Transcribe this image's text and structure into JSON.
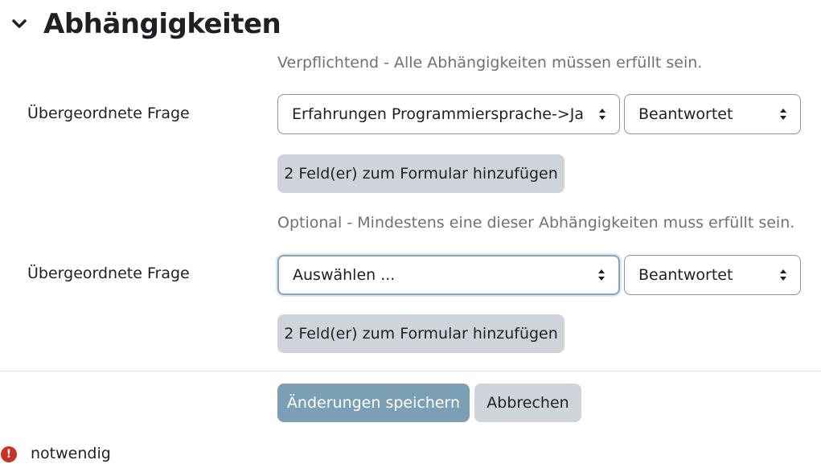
{
  "section": {
    "title": "Abhängigkeiten",
    "toggle_icon": "chevron-down-icon"
  },
  "mandatory": {
    "hint": "Verpflichtend - Alle Abhängigkeiten müssen erfüllt sein.",
    "label": "Übergeordnete Frage",
    "question_select": "Erfahrungen Programmiersprache->Ja",
    "condition_select": "Beantwortet",
    "add_button": "2 Feld(er) zum Formular hinzufügen"
  },
  "optional": {
    "hint": "Optional - Mindestens eine dieser Abhängigkeiten muss erfüllt sein.",
    "label": "Übergeordnete Frage",
    "question_select": "Auswählen ...",
    "condition_select": "Beantwortet",
    "add_button": "2 Feld(er) zum Formular hinzufügen"
  },
  "actions": {
    "save_label": "Änderungen speichern",
    "cancel_label": "Abbrechen"
  },
  "required_note": {
    "icon": "exclamation-circle-icon",
    "text": "notwendig"
  },
  "colors": {
    "primary_button": "#7b9fb4",
    "secondary_button": "#ced4da",
    "required_icon": "#ca3120"
  }
}
